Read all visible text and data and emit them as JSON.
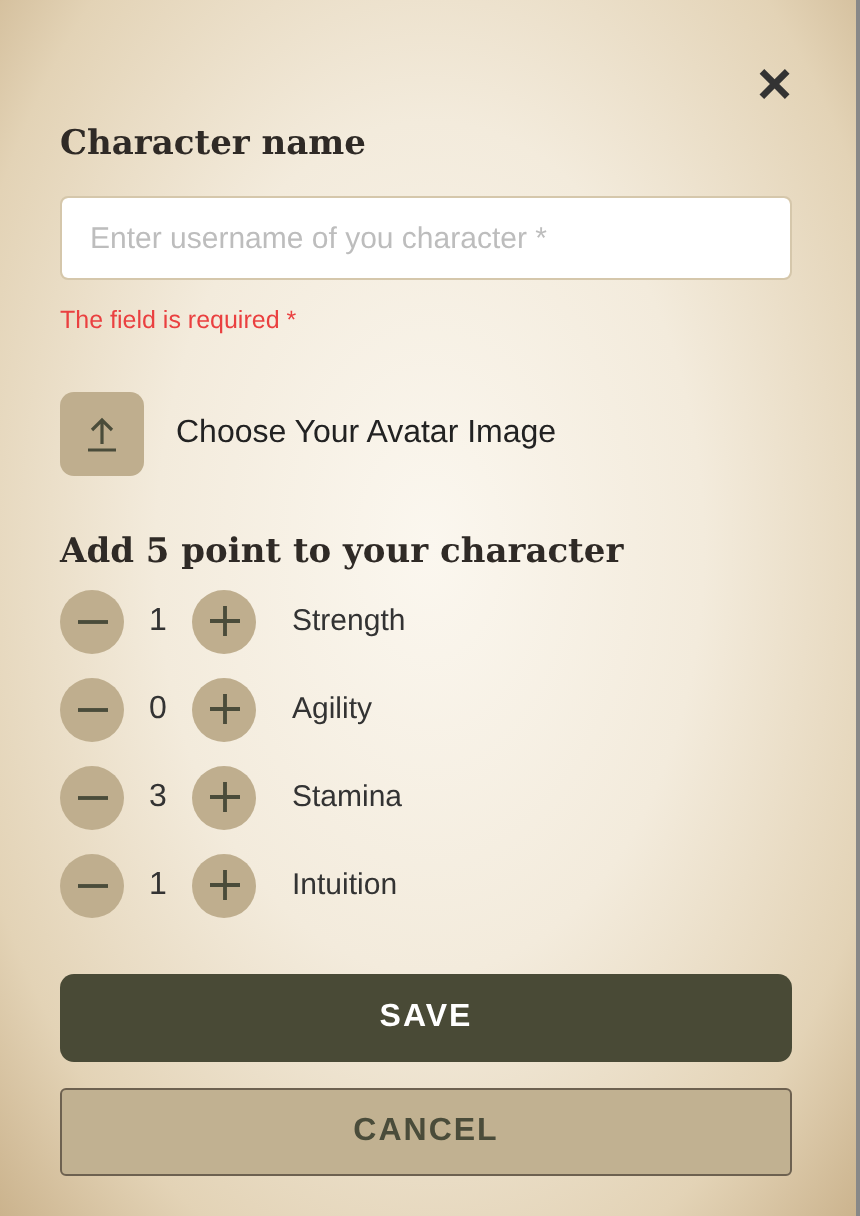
{
  "close": {
    "label": "×"
  },
  "name_section": {
    "title": "Character name",
    "placeholder": "Enter username of you character *",
    "error": "The field is required *"
  },
  "avatar": {
    "label": "Choose Your Avatar Image"
  },
  "points": {
    "title": "Add 5 point to your character",
    "stats": [
      {
        "value": "1",
        "label": "Strength"
      },
      {
        "value": "0",
        "label": "Agility"
      },
      {
        "value": "3",
        "label": "Stamina"
      },
      {
        "value": "1",
        "label": "Intuition"
      }
    ]
  },
  "buttons": [
    {
      "kind": "primary",
      "label": "SAVE"
    },
    {
      "kind": "secondary",
      "label": "CANCEL"
    }
  ]
}
